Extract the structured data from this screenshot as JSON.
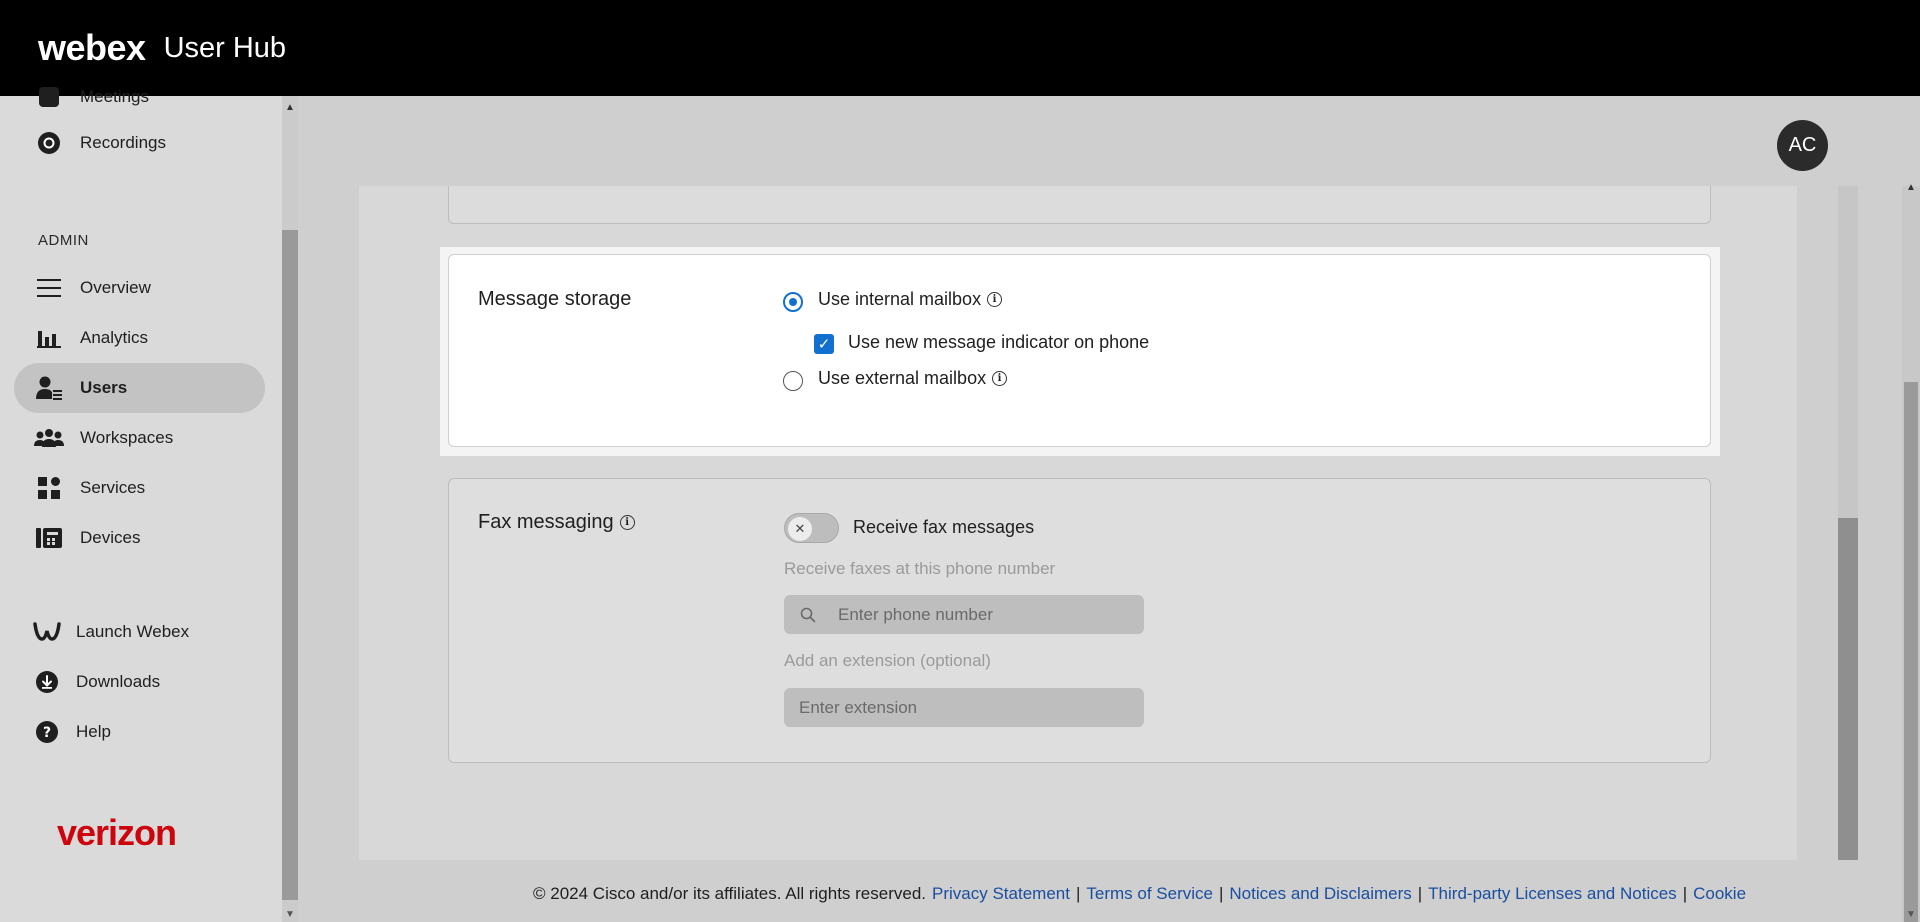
{
  "header": {
    "brand": "webex",
    "product": "User Hub"
  },
  "sidebar": {
    "items_top": [
      {
        "label": "Meetings",
        "icon": "meetings-icon"
      },
      {
        "label": "Recordings",
        "icon": "recordings-icon"
      }
    ],
    "admin_label": "ADMIN",
    "admin_items": [
      {
        "label": "Overview",
        "icon": "overview-icon"
      },
      {
        "label": "Analytics",
        "icon": "analytics-icon"
      },
      {
        "label": "Users",
        "icon": "users-icon",
        "active": true
      },
      {
        "label": "Workspaces",
        "icon": "workspaces-icon"
      },
      {
        "label": "Services",
        "icon": "services-icon"
      },
      {
        "label": "Devices",
        "icon": "devices-icon"
      }
    ],
    "bottom_items": [
      {
        "label": "Launch Webex",
        "icon": "webex-logo-icon"
      },
      {
        "label": "Downloads",
        "icon": "download-icon"
      },
      {
        "label": "Help",
        "icon": "help-icon"
      }
    ],
    "partner_logo": "verizon"
  },
  "avatar": {
    "initials": "AC"
  },
  "message_storage": {
    "title": "Message storage",
    "option_internal": "Use internal mailbox",
    "option_new_message_indicator": "Use new message indicator on phone",
    "option_external": "Use external mailbox",
    "selected": "internal",
    "indicator_checked": true
  },
  "fax_messaging": {
    "title": "Fax messaging",
    "toggle_label": "Receive fax messages",
    "toggle_on": false,
    "phone_label": "Receive faxes at this phone number",
    "phone_placeholder": "Enter phone number",
    "extension_label": "Add an extension (optional)",
    "extension_placeholder": "Enter extension"
  },
  "footer": {
    "copyright": "© 2024 Cisco and/or its affiliates. All rights reserved.",
    "links": [
      "Privacy Statement",
      "Terms of Service",
      "Notices and Disclaimers",
      "Third-party Licenses and Notices",
      "Cookie"
    ]
  },
  "colors": {
    "accent": "#1170cf",
    "brand_verizon": "#cd040b",
    "header_bg": "#000000"
  }
}
